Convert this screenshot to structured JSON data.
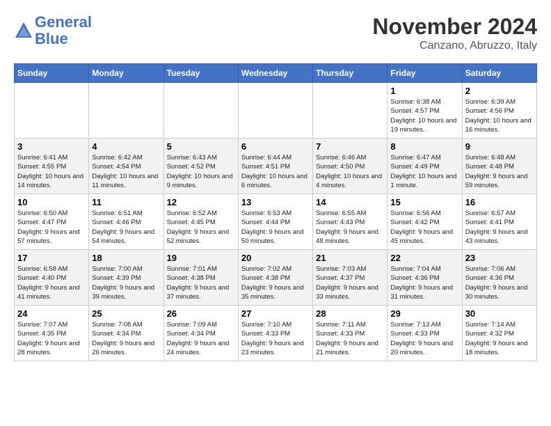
{
  "header": {
    "logo_line1": "General",
    "logo_line2": "Blue",
    "month_title": "November 2024",
    "location": "Canzano, Abruzzo, Italy"
  },
  "weekdays": [
    "Sunday",
    "Monday",
    "Tuesday",
    "Wednesday",
    "Thursday",
    "Friday",
    "Saturday"
  ],
  "weeks": [
    [
      {
        "num": "",
        "info": ""
      },
      {
        "num": "",
        "info": ""
      },
      {
        "num": "",
        "info": ""
      },
      {
        "num": "",
        "info": ""
      },
      {
        "num": "",
        "info": ""
      },
      {
        "num": "1",
        "info": "Sunrise: 6:38 AM\nSunset: 4:57 PM\nDaylight: 10 hours and 19 minutes."
      },
      {
        "num": "2",
        "info": "Sunrise: 6:39 AM\nSunset: 4:56 PM\nDaylight: 10 hours and 16 minutes."
      }
    ],
    [
      {
        "num": "3",
        "info": "Sunrise: 6:41 AM\nSunset: 4:55 PM\nDaylight: 10 hours and 14 minutes."
      },
      {
        "num": "4",
        "info": "Sunrise: 6:42 AM\nSunset: 4:54 PM\nDaylight: 10 hours and 11 minutes."
      },
      {
        "num": "5",
        "info": "Sunrise: 6:43 AM\nSunset: 4:52 PM\nDaylight: 10 hours and 9 minutes."
      },
      {
        "num": "6",
        "info": "Sunrise: 6:44 AM\nSunset: 4:51 PM\nDaylight: 10 hours and 6 minutes."
      },
      {
        "num": "7",
        "info": "Sunrise: 6:46 AM\nSunset: 4:50 PM\nDaylight: 10 hours and 4 minutes."
      },
      {
        "num": "8",
        "info": "Sunrise: 6:47 AM\nSunset: 4:49 PM\nDaylight: 10 hours and 1 minute."
      },
      {
        "num": "9",
        "info": "Sunrise: 6:48 AM\nSunset: 4:48 PM\nDaylight: 9 hours and 59 minutes."
      }
    ],
    [
      {
        "num": "10",
        "info": "Sunrise: 6:50 AM\nSunset: 4:47 PM\nDaylight: 9 hours and 57 minutes."
      },
      {
        "num": "11",
        "info": "Sunrise: 6:51 AM\nSunset: 4:46 PM\nDaylight: 9 hours and 54 minutes."
      },
      {
        "num": "12",
        "info": "Sunrise: 6:52 AM\nSunset: 4:45 PM\nDaylight: 9 hours and 52 minutes."
      },
      {
        "num": "13",
        "info": "Sunrise: 6:53 AM\nSunset: 4:44 PM\nDaylight: 9 hours and 50 minutes."
      },
      {
        "num": "14",
        "info": "Sunrise: 6:55 AM\nSunset: 4:43 PM\nDaylight: 9 hours and 48 minutes."
      },
      {
        "num": "15",
        "info": "Sunrise: 6:56 AM\nSunset: 4:42 PM\nDaylight: 9 hours and 45 minutes."
      },
      {
        "num": "16",
        "info": "Sunrise: 6:57 AM\nSunset: 4:41 PM\nDaylight: 9 hours and 43 minutes."
      }
    ],
    [
      {
        "num": "17",
        "info": "Sunrise: 6:58 AM\nSunset: 4:40 PM\nDaylight: 9 hours and 41 minutes."
      },
      {
        "num": "18",
        "info": "Sunrise: 7:00 AM\nSunset: 4:39 PM\nDaylight: 9 hours and 39 minutes."
      },
      {
        "num": "19",
        "info": "Sunrise: 7:01 AM\nSunset: 4:38 PM\nDaylight: 9 hours and 37 minutes."
      },
      {
        "num": "20",
        "info": "Sunrise: 7:02 AM\nSunset: 4:38 PM\nDaylight: 9 hours and 35 minutes."
      },
      {
        "num": "21",
        "info": "Sunrise: 7:03 AM\nSunset: 4:37 PM\nDaylight: 9 hours and 33 minutes."
      },
      {
        "num": "22",
        "info": "Sunrise: 7:04 AM\nSunset: 4:36 PM\nDaylight: 9 hours and 31 minutes."
      },
      {
        "num": "23",
        "info": "Sunrise: 7:06 AM\nSunset: 4:36 PM\nDaylight: 9 hours and 30 minutes."
      }
    ],
    [
      {
        "num": "24",
        "info": "Sunrise: 7:07 AM\nSunset: 4:35 PM\nDaylight: 9 hours and 28 minutes."
      },
      {
        "num": "25",
        "info": "Sunrise: 7:08 AM\nSunset: 4:34 PM\nDaylight: 9 hours and 26 minutes."
      },
      {
        "num": "26",
        "info": "Sunrise: 7:09 AM\nSunset: 4:34 PM\nDaylight: 9 hours and 24 minutes."
      },
      {
        "num": "27",
        "info": "Sunrise: 7:10 AM\nSunset: 4:33 PM\nDaylight: 9 hours and 23 minutes."
      },
      {
        "num": "28",
        "info": "Sunrise: 7:11 AM\nSunset: 4:33 PM\nDaylight: 9 hours and 21 minutes."
      },
      {
        "num": "29",
        "info": "Sunrise: 7:13 AM\nSunset: 4:33 PM\nDaylight: 9 hours and 20 minutes."
      },
      {
        "num": "30",
        "info": "Sunrise: 7:14 AM\nSunset: 4:32 PM\nDaylight: 9 hours and 18 minutes."
      }
    ]
  ]
}
